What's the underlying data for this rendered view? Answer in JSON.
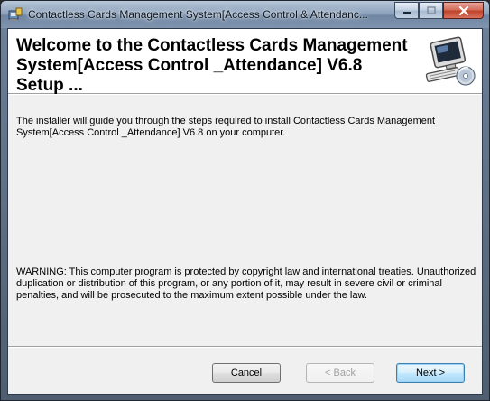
{
  "window": {
    "title": "Contactless Cards Management System[Access Control & Attendanc...",
    "caption_buttons": {
      "minimize_icon": "minimize-icon",
      "maximize_icon": "maximize-icon",
      "close_icon": "close-icon"
    }
  },
  "banner": {
    "title": "Welcome to the Contactless Cards Management\nSystem[Access Control _Attendance] V6.8 Setup ...",
    "icon": "computer-setup-icon"
  },
  "body": {
    "intro": "The installer will guide you through the steps required to install Contactless Cards Management System[Access Control _Attendance] V6.8 on your computer.",
    "warning": "WARNING: This computer program is protected by copyright law and international treaties. Unauthorized duplication or distribution of this program, or any portion of it, may result in severe civil or criminal penalties, and will be prosecuted to the maximum extent possible under the law."
  },
  "buttons": {
    "cancel": "Cancel",
    "back": "< Back",
    "next": "Next >"
  },
  "colors": {
    "close_button": "#c0432b",
    "default_button_border": "#3c7fb1",
    "dialog_background": "#f0f0f0"
  }
}
